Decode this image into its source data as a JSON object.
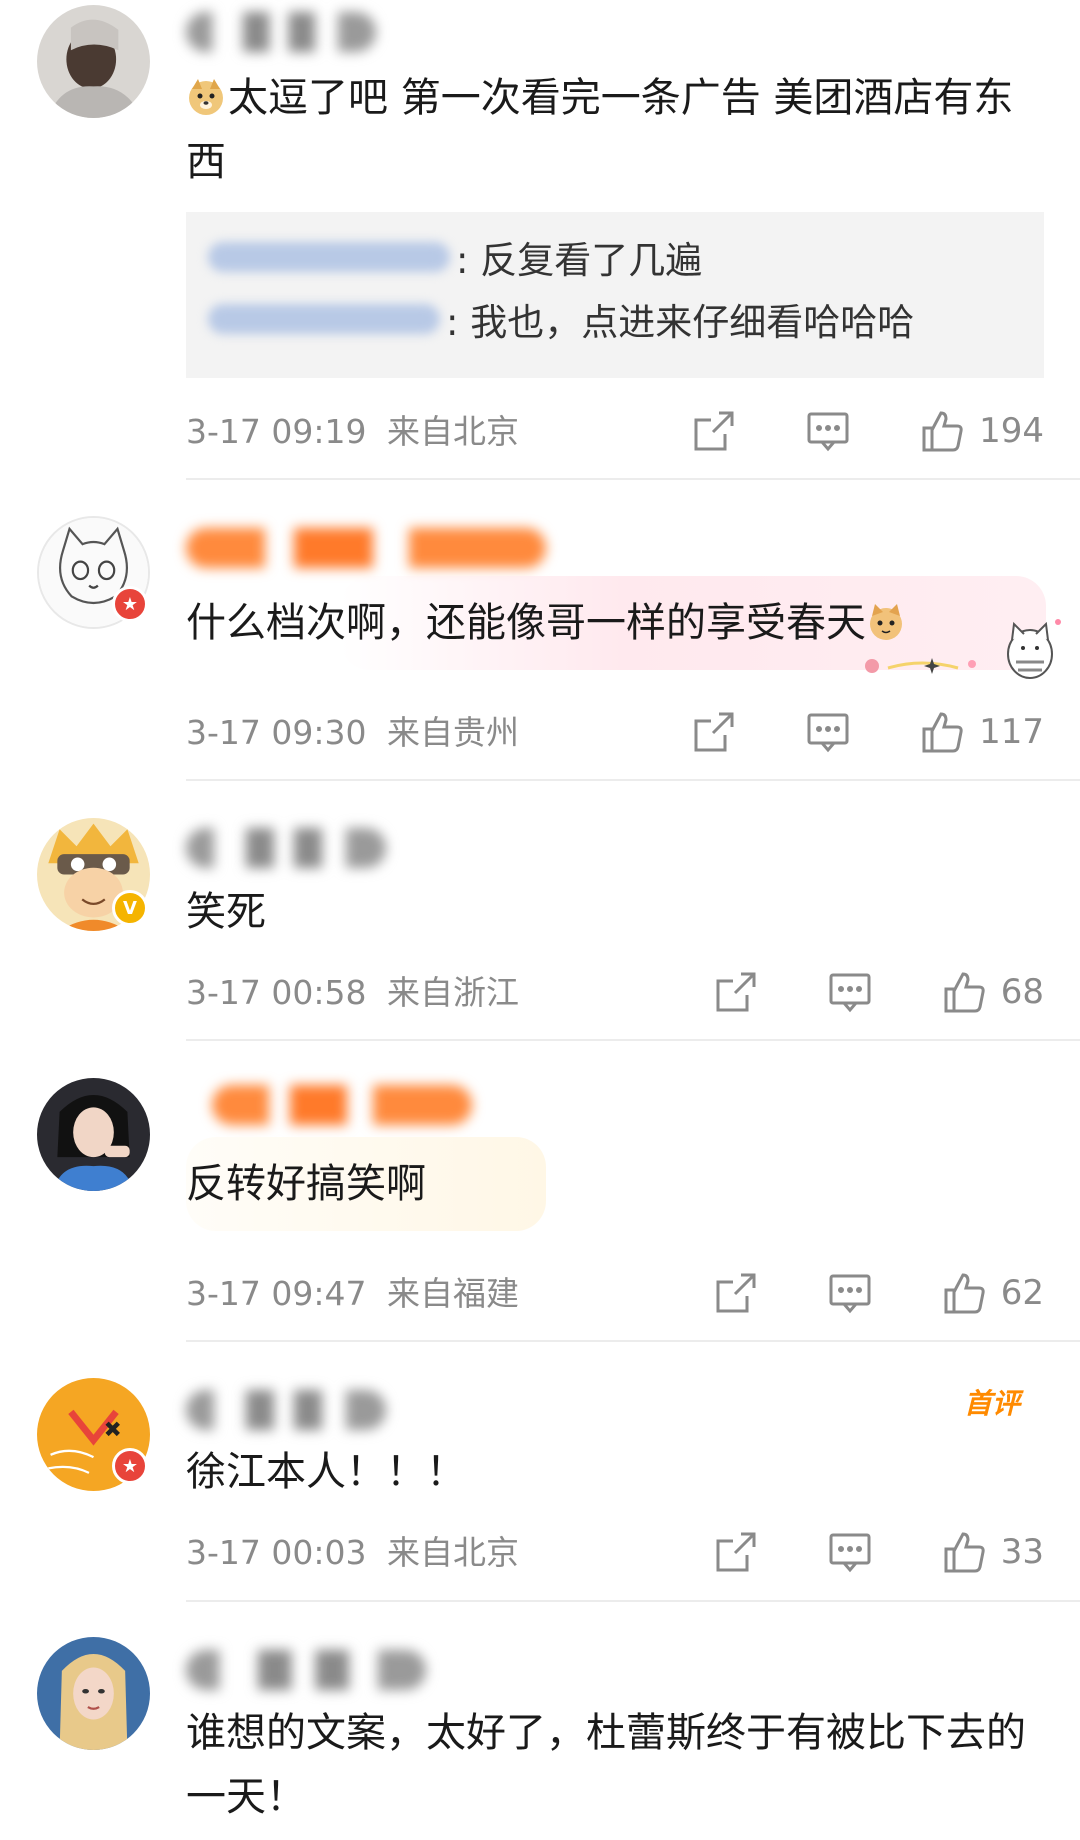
{
  "comments": [
    {
      "text": "太逗了吧 第一次看完一条广告 美团酒店有东西",
      "replies": [
        {
          "text": ": 反复看了几遍"
        },
        {
          "text": ": 我也，点进来仔细看哈哈哈"
        }
      ],
      "time": "3-17 09:19",
      "location": "来自北京",
      "likes": "194"
    },
    {
      "text": "什么档次啊，还能像哥一样的享受春天",
      "time": "3-17 09:30",
      "location": "来自贵州",
      "likes": "117"
    },
    {
      "text": "笑死",
      "time": "3-17 00:58",
      "location": "来自浙江",
      "likes": "68"
    },
    {
      "text": "反转好搞笑啊",
      "time": "3-17 09:47",
      "location": "来自福建",
      "likes": "62"
    },
    {
      "text": "徐江本人！！！",
      "tag": "首评",
      "time": "3-17 00:03",
      "location": "来自北京",
      "likes": "33"
    },
    {
      "text": "谁想的文案，太好了，杜蕾斯终于有被比下去的一天！"
    }
  ],
  "icons": {
    "share": "share-icon",
    "comment": "comment-icon",
    "like": "thumbs-up-icon"
  },
  "colors": {
    "meta_gray": "#8a8a8a",
    "divider": "#ececec",
    "reply_bg": "#f3f3f3",
    "first_tag": "#ff8a00",
    "badge_red": "#e8443a",
    "badge_gold": "#f5b400"
  }
}
